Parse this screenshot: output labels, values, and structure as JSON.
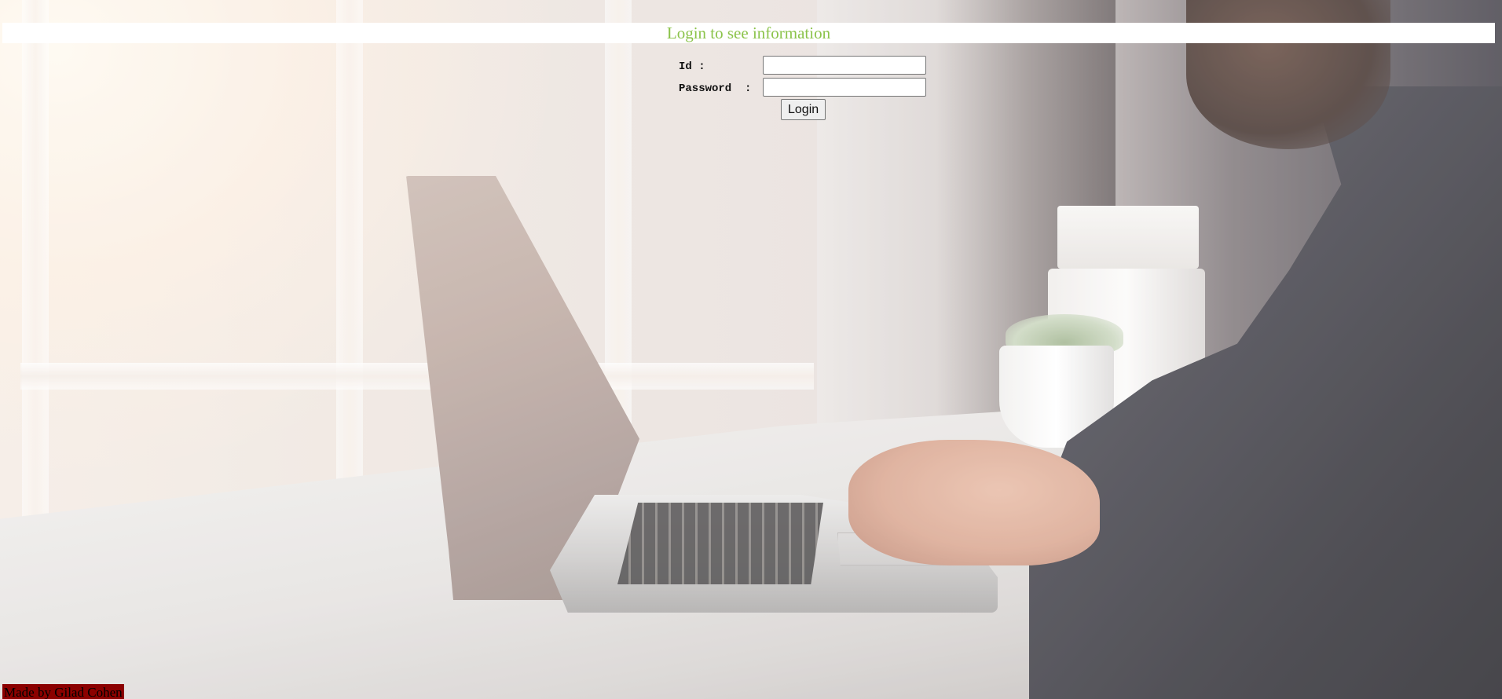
{
  "header": {
    "title": "Login to see information",
    "title_color": "#8bc34a"
  },
  "login_form": {
    "id_label": "Id :",
    "id_value": "",
    "password_label": "Password  :",
    "password_value": "",
    "submit_label": "Login"
  },
  "footer": {
    "credit": "Made by Gilad Cohen",
    "background_color": "#8b0000"
  },
  "background": {
    "icon": "laptop-workspace-photo"
  }
}
